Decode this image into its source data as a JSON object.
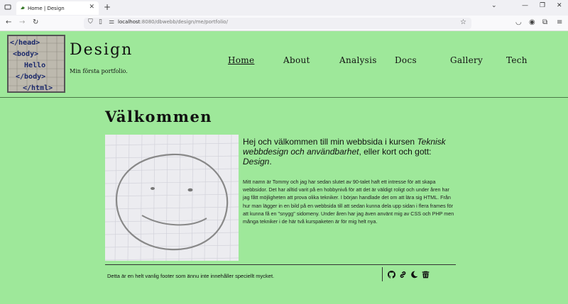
{
  "browser": {
    "tab_title": "Home | Design",
    "url_host": "localhost",
    "url_rest": ":8080/dbwebb/design/me/portfolio/"
  },
  "header": {
    "site_title": "Design",
    "slogan": "Min första portfolio.",
    "logo_text": [
      "</head>",
      "<body>",
      "Hello",
      "</body>",
      "</html>"
    ]
  },
  "nav": {
    "items": [
      {
        "label": "Home",
        "active": true
      },
      {
        "label": "About"
      },
      {
        "label": "Analysis"
      },
      {
        "label": "Docs"
      },
      {
        "label": "Gallery"
      },
      {
        "label": "Tech"
      }
    ]
  },
  "main": {
    "heading": "Välkommen",
    "lead_1": "Hej och välkommen till min webbsida i kursen ",
    "lead_course": "Teknisk webbdesign och användbarhet",
    "lead_2": ", eller kort och gott: ",
    "lead_short": "Design",
    "lead_3": ".",
    "body": "Mitt namn är Tommy och jag har sedan slutet av 90-talet haft ett intresse för att skapa webbsidor. Det har alltid varit på en hobbynivå för att det är väldigt roligt och under åren har jag fått möjligheten att prova olika tekniker. I början handlade det om att lära sig HTML. Från hur man lägger in en bild på en webbsida till att sedan kunna dela upp sidan i flera frames för att kunna få en \"snygg\" sidomeny. Under åren har jag även använt mig av CSS och PHP men många tekniker i de här två kurspaketen är för mig helt nya."
  },
  "footer": {
    "text": "Detta är en helt vanlig footer som ännu inte innehåller speciellt mycket.",
    "icons": [
      "github-icon",
      "link-icon",
      "moon-icon",
      "trash-icon"
    ]
  }
}
